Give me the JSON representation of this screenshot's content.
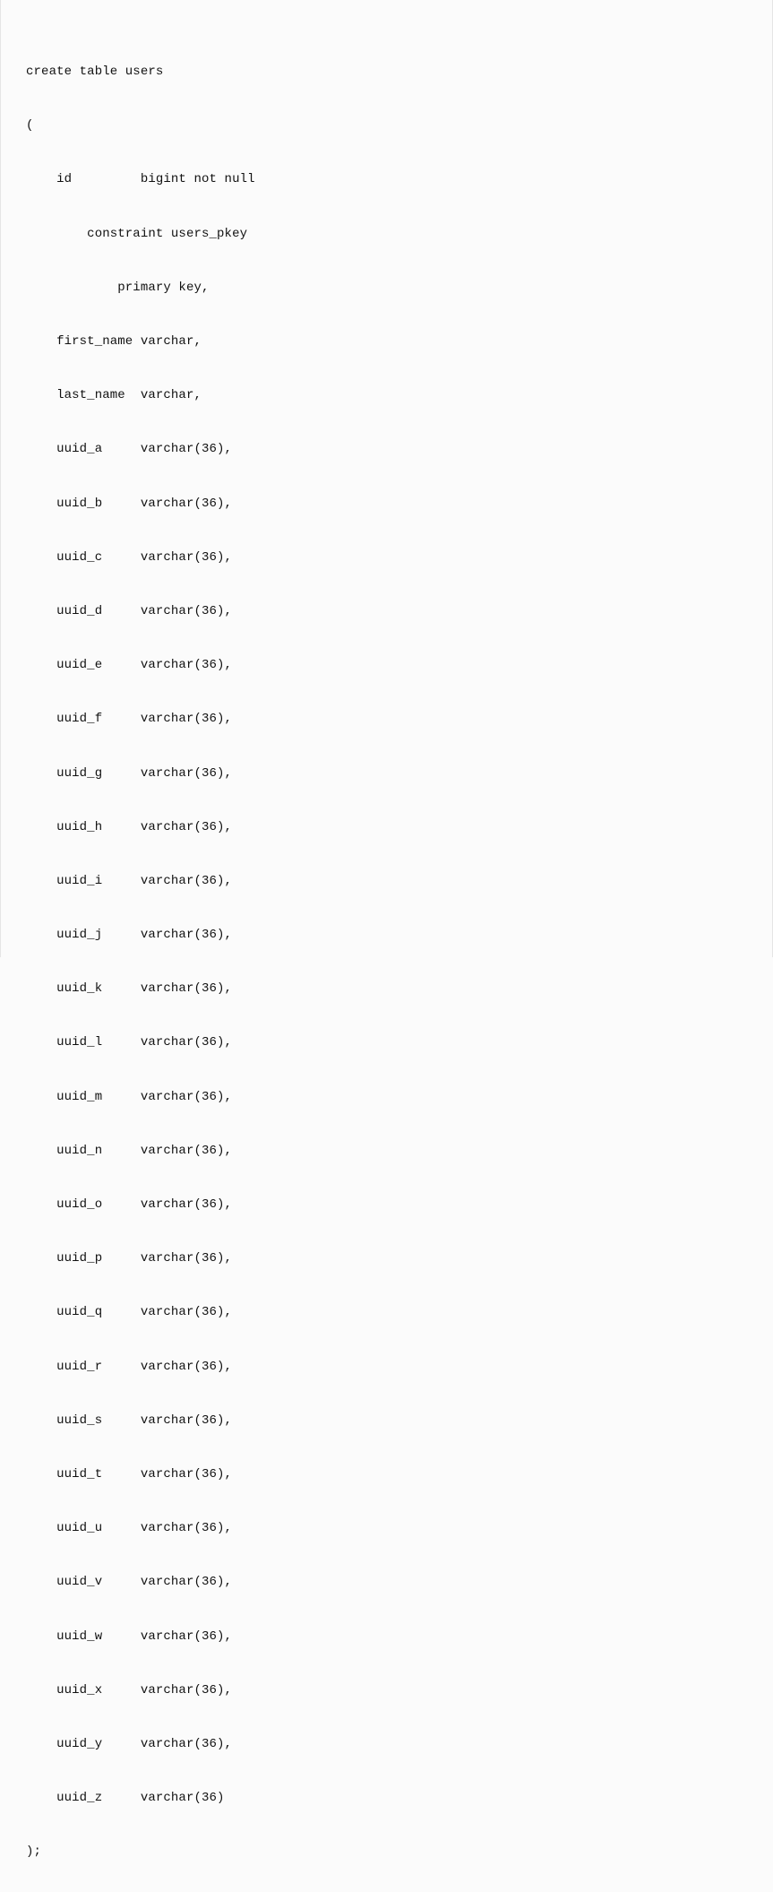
{
  "sql": {
    "lines": [
      "create table users",
      "(",
      "    id         bigint not null",
      "        constraint users_pkey",
      "            primary key,",
      "    first_name varchar,",
      "    last_name  varchar,",
      "    uuid_a     varchar(36),",
      "    uuid_b     varchar(36),",
      "    uuid_c     varchar(36),",
      "    uuid_d     varchar(36),",
      "    uuid_e     varchar(36),",
      "    uuid_f     varchar(36),",
      "    uuid_g     varchar(36),",
      "    uuid_h     varchar(36),",
      "    uuid_i     varchar(36),",
      "    uuid_j     varchar(36),",
      "    uuid_k     varchar(36),",
      "    uuid_l     varchar(36),",
      "    uuid_m     varchar(36),",
      "    uuid_n     varchar(36),",
      "    uuid_o     varchar(36),",
      "    uuid_p     varchar(36),",
      "    uuid_q     varchar(36),",
      "    uuid_r     varchar(36),",
      "    uuid_s     varchar(36),",
      "    uuid_t     varchar(36),",
      "    uuid_u     varchar(36),",
      "    uuid_v     varchar(36),",
      "    uuid_w     varchar(36),",
      "    uuid_x     varchar(36),",
      "    uuid_y     varchar(36),",
      "    uuid_z     varchar(36)",
      ");"
    ]
  }
}
